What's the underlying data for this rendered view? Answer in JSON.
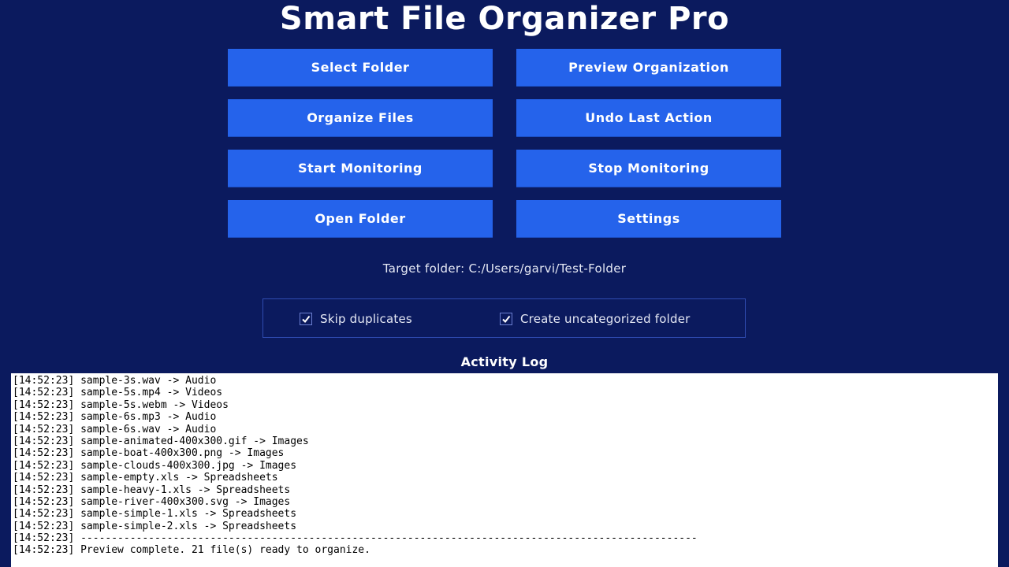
{
  "app": {
    "title": "Smart File Organizer Pro"
  },
  "buttons": [
    {
      "label": "Select Folder"
    },
    {
      "label": "Preview Organization"
    },
    {
      "label": "Organize Files"
    },
    {
      "label": "Undo Last Action"
    },
    {
      "label": "Start Monitoring"
    },
    {
      "label": "Stop Monitoring"
    },
    {
      "label": "Open Folder"
    },
    {
      "label": "Settings"
    }
  ],
  "target_folder": {
    "text": "Target folder: C:/Users/garvi/Test-Folder"
  },
  "options": {
    "skip_duplicates": {
      "label": "Skip duplicates",
      "checked": true
    },
    "uncategorized": {
      "label": "Create uncategorized folder",
      "checked": true
    }
  },
  "activity_log": {
    "title": "Activity Log",
    "lines": [
      "[14:52:23] sample-3s.wav -> Audio",
      "[14:52:23] sample-5s.mp4 -> Videos",
      "[14:52:23] sample-5s.webm -> Videos",
      "[14:52:23] sample-6s.mp3 -> Audio",
      "[14:52:23] sample-6s.wav -> Audio",
      "[14:52:23] sample-animated-400x300.gif -> Images",
      "[14:52:23] sample-boat-400x300.png -> Images",
      "[14:52:23] sample-clouds-400x300.jpg -> Images",
      "[14:52:23] sample-empty.xls -> Spreadsheets",
      "[14:52:23] sample-heavy-1.xls -> Spreadsheets",
      "[14:52:23] sample-river-400x300.svg -> Images",
      "[14:52:23] sample-simple-1.xls -> Spreadsheets",
      "[14:52:23] sample-simple-2.xls -> Spreadsheets",
      "[14:52:23] ----------------------------------------------------------------------------------------------------",
      "[14:52:23] Preview complete. 21 file(s) ready to organize."
    ]
  },
  "colors": {
    "background": "#0b1a5e",
    "button": "#2563eb",
    "log_background": "#ffffff"
  }
}
